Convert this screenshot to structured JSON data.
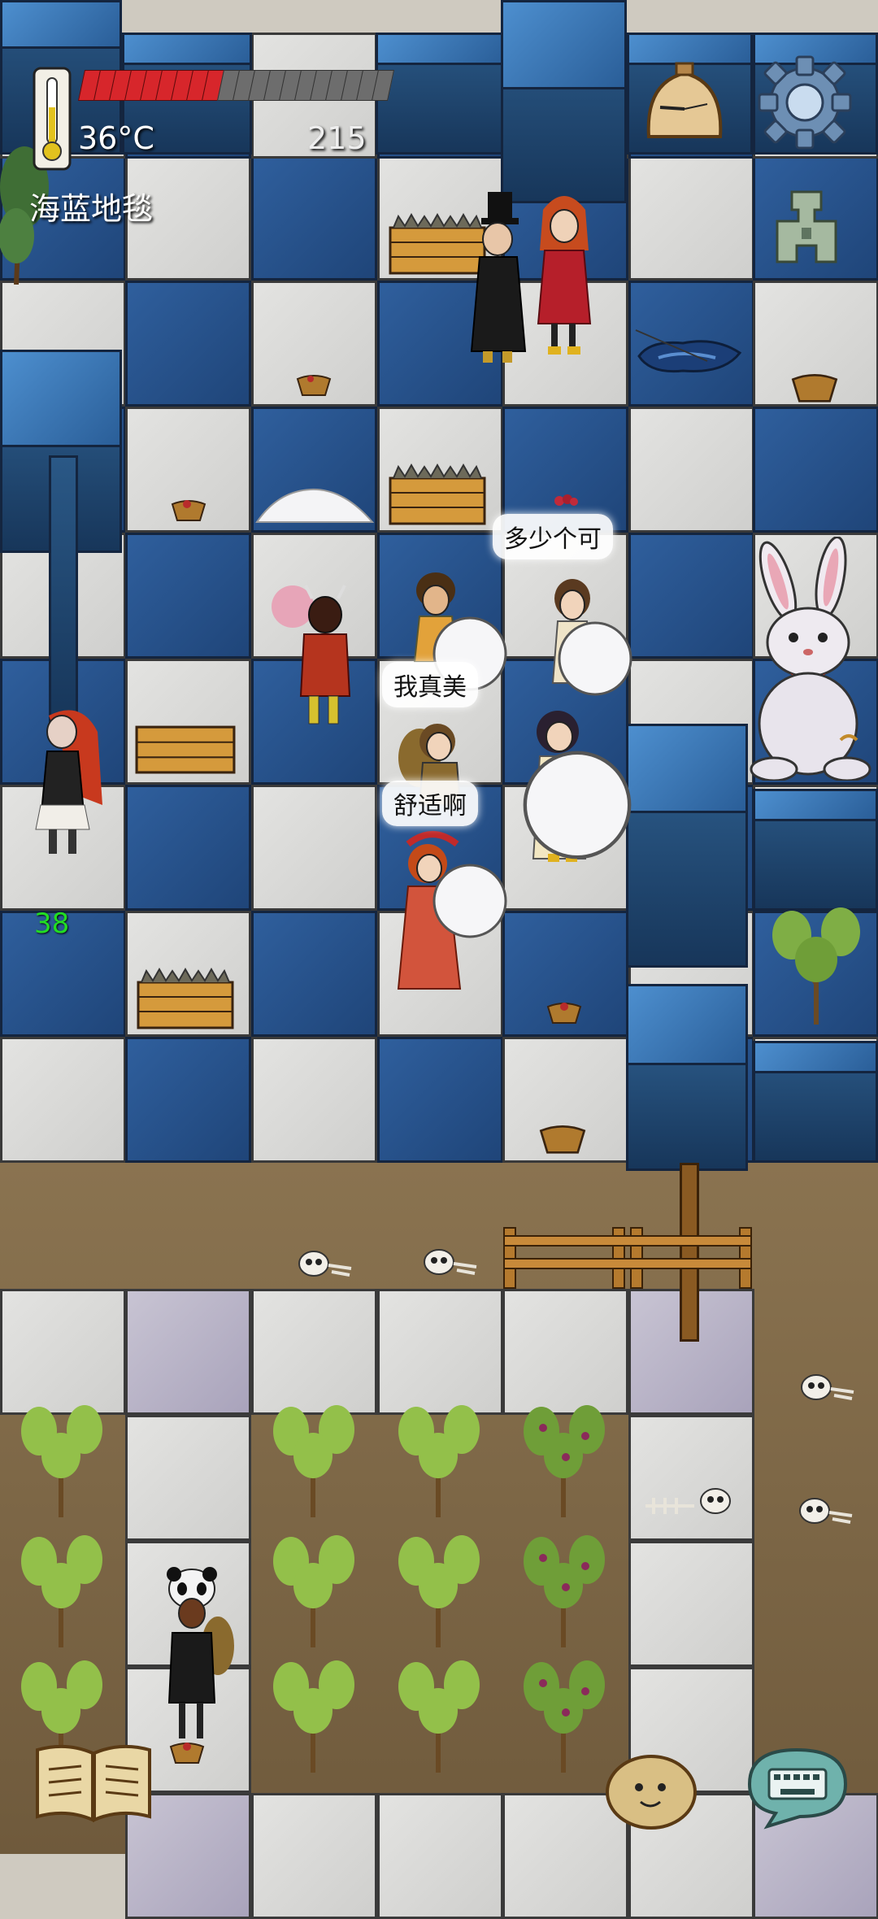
{
  "hud": {
    "temperature": "36°C",
    "score": "215",
    "tile_name": "海蓝地毯",
    "player_count": "38",
    "food_level": 0.45,
    "food_segments_total": 20,
    "food_segments_filled": 9
  },
  "speech": {
    "bubble_1": "多少个可",
    "bubble_2": "我真美",
    "bubble_3": "舒适啊"
  },
  "colors": {
    "carpet_blue": "#2f5f9d",
    "carpet_white": "#dcdcd9",
    "wall_blue": "#3f7fc0",
    "food_red": "#d7262b",
    "count_green": "#22dd22",
    "dirt": "#7d6646"
  },
  "icons": {
    "thermometer": "thermometer-icon",
    "clock": "pocket-watch-icon",
    "settings": "gear-icon",
    "tech": "coin-ancient-icon",
    "book": "open-book-icon",
    "emote": "potato-face-icon",
    "keyboard": "keyboard-icon"
  }
}
